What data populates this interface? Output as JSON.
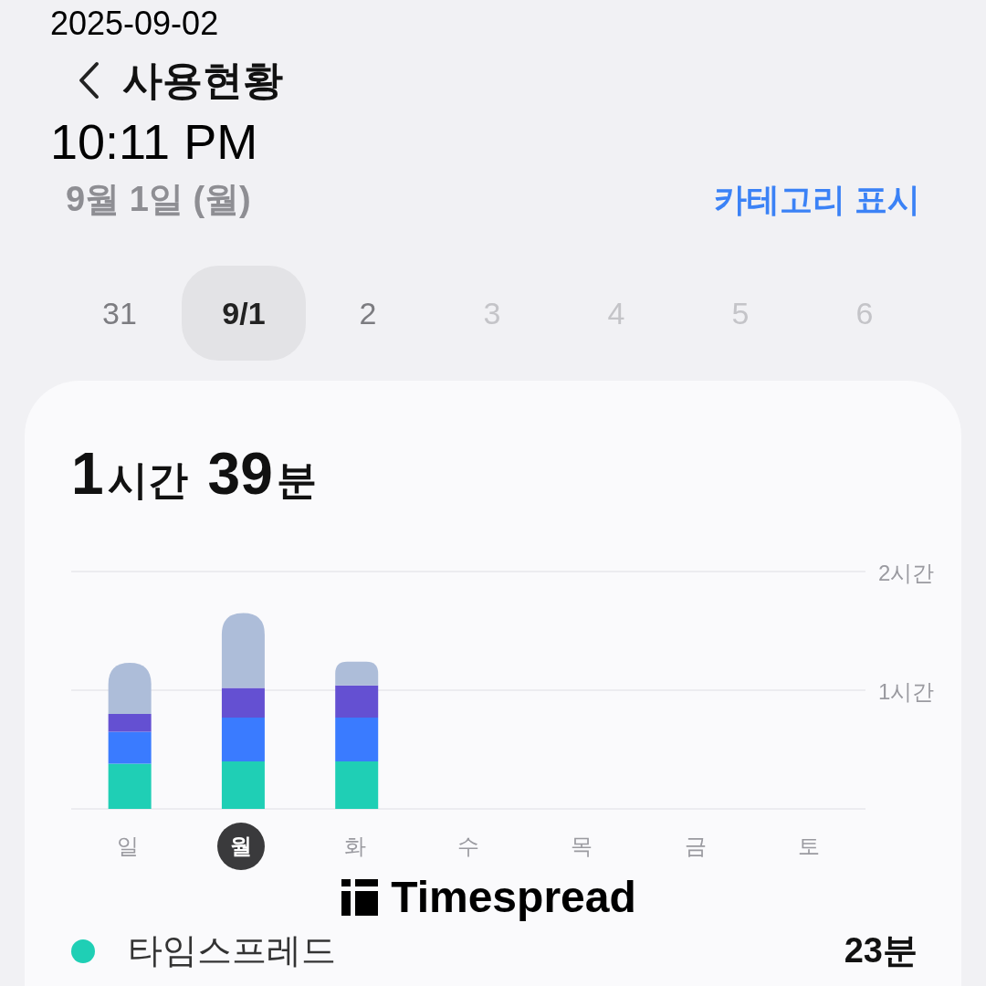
{
  "header": {
    "title": "사용현황"
  },
  "timestamp": {
    "date": "2025-09-02",
    "time": "10:11 PM"
  },
  "date_label": "9월 1일 (월)",
  "category_toggle": "카테고리 표시",
  "date_strip": [
    {
      "label": "31",
      "selected": false,
      "disabled": false
    },
    {
      "label": "9/1",
      "selected": true,
      "disabled": false
    },
    {
      "label": "2",
      "selected": false,
      "disabled": false
    },
    {
      "label": "3",
      "selected": false,
      "disabled": true
    },
    {
      "label": "4",
      "selected": false,
      "disabled": true
    },
    {
      "label": "5",
      "selected": false,
      "disabled": true
    },
    {
      "label": "6",
      "selected": false,
      "disabled": true
    }
  ],
  "card": {
    "total": {
      "hours": "1",
      "hours_unit": "시간",
      "minutes": "39",
      "minutes_unit": "분"
    },
    "chart_data": {
      "type": "bar",
      "stacked": true,
      "categories": [
        "일",
        "월",
        "화",
        "수",
        "목",
        "금",
        "토"
      ],
      "ylim": [
        0,
        2
      ],
      "yticks": [
        {
          "value": 1,
          "label": "1시간"
        },
        {
          "value": 2,
          "label": "2시간"
        }
      ],
      "series": [
        {
          "color": "#1fcfb5",
          "values": [
            0.38,
            0.4,
            0.4,
            null,
            null,
            null,
            null
          ]
        },
        {
          "color": "#3a7bff",
          "values": [
            0.27,
            0.37,
            0.37,
            null,
            null,
            null,
            null
          ]
        },
        {
          "color": "#6450d2",
          "values": [
            0.15,
            0.25,
            0.27,
            null,
            null,
            null,
            null
          ]
        },
        {
          "color": "#adbdd9",
          "values": [
            0.43,
            0.63,
            0.2,
            null,
            null,
            null,
            null
          ]
        }
      ]
    },
    "days": [
      {
        "selected": false
      },
      {
        "selected": true
      },
      {
        "selected": false
      },
      {
        "selected": false
      },
      {
        "selected": false
      },
      {
        "selected": false
      },
      {
        "selected": false
      }
    ],
    "brand": "Timespread",
    "legend": [
      {
        "name": "타임스프레드",
        "value": "23분",
        "color": "#1fcfb5"
      }
    ]
  }
}
